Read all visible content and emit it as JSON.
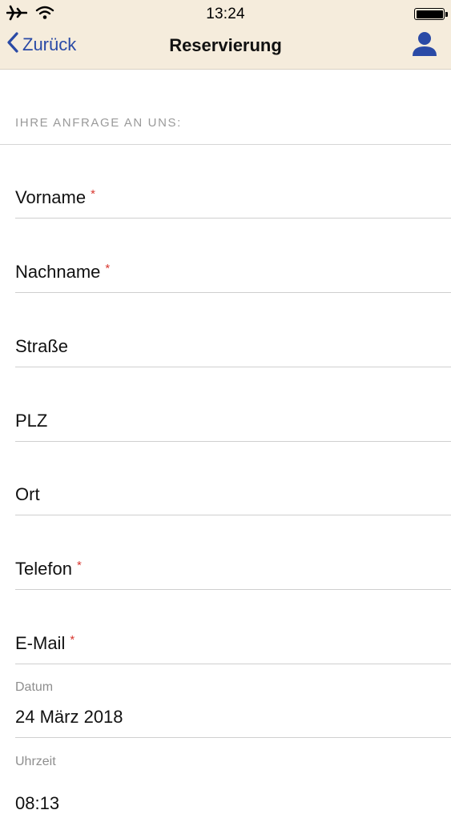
{
  "status_bar": {
    "time": "13:24",
    "icons": [
      "airplane-icon",
      "wifi-icon",
      "battery-icon"
    ]
  },
  "nav": {
    "back_label": "Zurück",
    "title": "Reservierung",
    "profile_icon": "person-icon",
    "accent_color": "#2a4aa6",
    "bar_color": "#f5ecdc"
  },
  "form": {
    "section_title": "IHRE ANFRAGE AN UNS:",
    "required_marker": "*",
    "required_color": "#d8372f",
    "fields": [
      {
        "label": "Vorname",
        "required": true
      },
      {
        "label": "Nachname",
        "required": true
      },
      {
        "label": "Straße",
        "required": false
      },
      {
        "label": "PLZ",
        "required": false
      },
      {
        "label": "Ort",
        "required": false
      },
      {
        "label": "Telefon",
        "required": true
      },
      {
        "label": "E-Mail",
        "required": true
      }
    ],
    "date": {
      "label": "Datum",
      "value": "24 März 2018"
    },
    "time": {
      "label": "Uhrzeit",
      "value": "08:13"
    }
  }
}
